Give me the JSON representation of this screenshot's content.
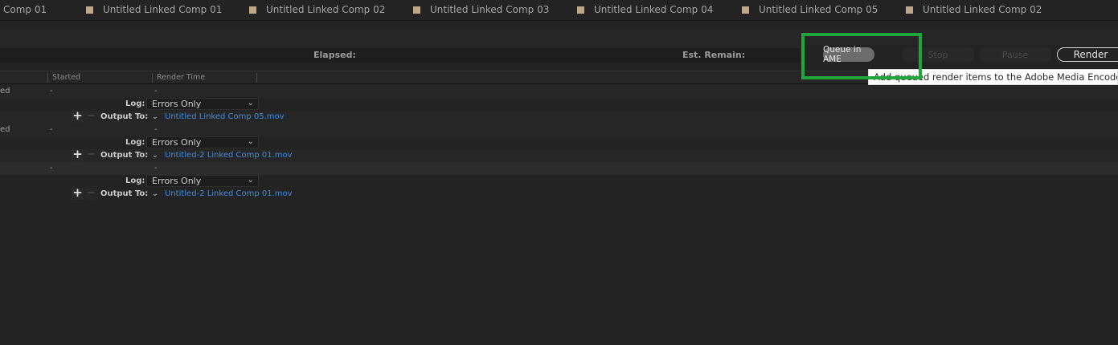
{
  "tabs": [
    {
      "label": "Comp 01",
      "square": false
    },
    {
      "label": "Untitled Linked Comp 01",
      "square": true
    },
    {
      "label": "Untitled Linked Comp 02",
      "square": true
    },
    {
      "label": "Untitled Linked Comp 03",
      "square": true
    },
    {
      "label": "Untitled Linked Comp 04",
      "square": true
    },
    {
      "label": "Untitled Linked Comp 05",
      "square": true
    },
    {
      "label": "Untitled Linked Comp 02",
      "square": true
    }
  ],
  "status": {
    "elapsed_label": "Elapsed:",
    "est_remain_label": "Est. Remain:"
  },
  "buttons": {
    "queue_ame": "Queue in AME",
    "stop": "Stop",
    "pause": "Pause",
    "render": "Render"
  },
  "tooltip": "Add queued render items to the Adobe Media Encoder queue",
  "columns": {
    "started": "Started",
    "render_time": "Render Time"
  },
  "items": [
    {
      "status_fragment": "ed",
      "started": "-",
      "render_time": "-",
      "log_label": "Log:",
      "log_value": "Errors Only",
      "output_label": "Output To:",
      "output_file": "Untitled Linked Comp 05.mov"
    },
    {
      "status_fragment": "ed",
      "started": "-",
      "render_time": "-",
      "log_label": "Log:",
      "log_value": "Errors Only",
      "output_label": "Output To:",
      "output_file": "Untitled-2 Linked Comp 01.mov"
    },
    {
      "status_fragment": "",
      "started": "-",
      "render_time": "-",
      "log_label": "Log:",
      "log_value": "Errors Only",
      "output_label": "Output To:",
      "output_file": "Untitled-2 Linked Comp 01.mov"
    }
  ],
  "icons": {
    "tab_square": "footage-square-icon",
    "chevron": "chevron-down-icon",
    "plus": "plus-icon",
    "minus": "minus-icon"
  },
  "colors": {
    "highlight": "#1ea53c",
    "link": "#3d8de0",
    "tab_square": "#bfa888"
  }
}
